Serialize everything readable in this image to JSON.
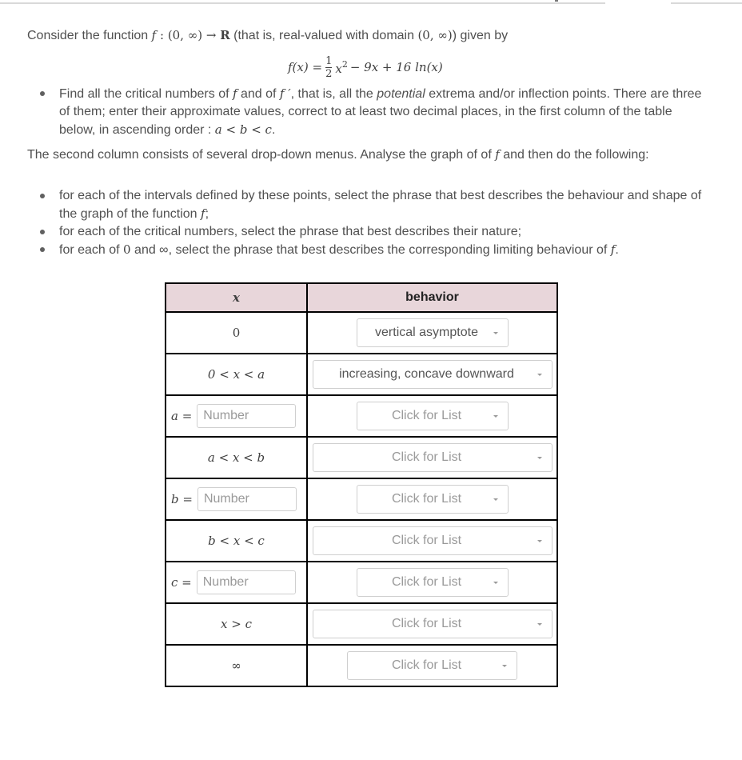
{
  "intro": {
    "prefix": "Consider the function ",
    "f": "f",
    "colon": " : ",
    "domain": "(0, ∞) → ",
    "reals": "R",
    "middle": " (that is, real-valued with domain ",
    "domain2": "(0, ∞)",
    "suffix": ") given by"
  },
  "formula": {
    "lhs": "f(x) = ",
    "num": "1",
    "den": "2",
    "x": "x",
    "exp": "2",
    "rest": " − 9x + 16 ln(x)"
  },
  "bullet1": {
    "t1": "Find all the critical numbers of ",
    "f": "f",
    "t2": " and of ",
    "fp": "f ′",
    "t3": ", that is, all the ",
    "em": "potential",
    "t4": " extrema and/or inflection points. There are three of them; enter their approximate values, correct to at least two decimal places, in the first column of the table below, in ascending order : ",
    "order": "a < b < c",
    "t5": "."
  },
  "paragraph2": {
    "t1": "The second column consists of several drop-down menus.  Analyse the graph of of ",
    "f": "f",
    "t2": " and then do the following:"
  },
  "bullets2": [
    {
      "t1": "for each of the intervals defined by these points, select the phrase that best describes the behaviour and shape of the graph of the function ",
      "m": "f",
      "t2": ";"
    },
    {
      "t1": "for each of the critical numbers, select the phrase that best describes their nature;",
      "m": "",
      "t2": ""
    },
    {
      "t1": "for each of ",
      "m": "0",
      "t2": " and ∞, select the phrase that best describes the corresponding limiting behaviour of ",
      "m2": "f",
      "t3": "."
    }
  ],
  "table": {
    "header": {
      "x": "x",
      "behavior": "behavior"
    },
    "rows": [
      {
        "x": "0",
        "behavior": "vertical asymptote"
      },
      {
        "x": "0 < x < a",
        "behavior": "increasing, concave downward"
      },
      {
        "x_label": "a =",
        "placeholder": "Number",
        "value": "",
        "behavior": "Click for List"
      },
      {
        "x": "a < x < b",
        "behavior": "Click for List"
      },
      {
        "x_label": "b =",
        "placeholder": "Number",
        "value": "",
        "behavior": "Click for List"
      },
      {
        "x": "b < x < c",
        "behavior": "Click for List"
      },
      {
        "x_label": "c =",
        "placeholder": "Number",
        "value": "",
        "behavior": "Click for List"
      },
      {
        "x": "x > c",
        "behavior": "Click for List"
      },
      {
        "x": "∞",
        "behavior": "Click for List"
      }
    ]
  },
  "colors": {
    "header_bg": "#e8d6da",
    "text": "#505050",
    "placeholder": "#9a9a9a"
  }
}
